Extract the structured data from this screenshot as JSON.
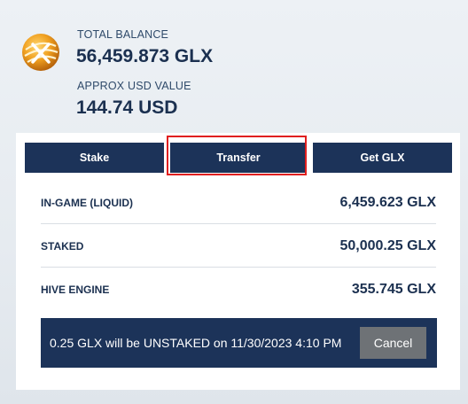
{
  "balance": {
    "total_label": "TOTAL BALANCE",
    "total_value": "56,459.873 GLX",
    "usd_label": "APPROX USD VALUE",
    "usd_value": "144.74 USD"
  },
  "tabs": [
    {
      "label": "Stake"
    },
    {
      "label": "Transfer"
    },
    {
      "label": "Get GLX"
    }
  ],
  "rows": [
    {
      "label": "IN-GAME (LIQUID)",
      "value": "6,459.623 GLX"
    },
    {
      "label": "STAKED",
      "value": "50,000.25 GLX"
    },
    {
      "label": "HIVE ENGINE",
      "value": "355.745 GLX"
    }
  ],
  "notice": {
    "text": "0.25 GLX will be UNSTAKED on 11/30/2023 4:10 PM",
    "cancel_label": "Cancel"
  },
  "colors": {
    "primary_navy": "#1c3359",
    "highlight_red": "#e01f1f",
    "cancel_gray": "#6e7276",
    "logo_orange": "#f0a020"
  },
  "icons": {
    "logo": "glx-coin-logo"
  }
}
